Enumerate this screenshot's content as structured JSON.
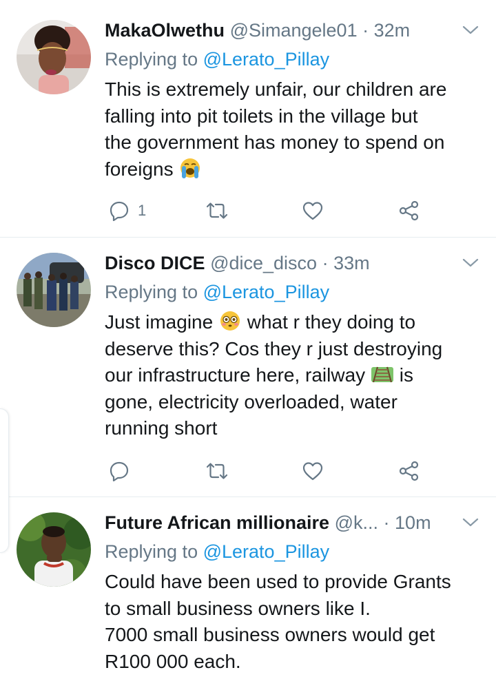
{
  "tweets": [
    {
      "name": "MakaOlwethu",
      "handle": "@Simangele01",
      "dot": "·",
      "time": "32m",
      "replying_prefix": "Replying to",
      "replying_to": "@Lerato_Pillay",
      "lines": [
        "This is extremely unfair, our children are",
        "falling into pit toilets in  the village but",
        "the government has money to spend on",
        "foreigns"
      ],
      "emoji": "loudly-crying-face-emoji",
      "reply_count": "1"
    },
    {
      "name": "Disco DICE",
      "handle": "@dice_disco",
      "dot": "·",
      "time": "33m",
      "replying_prefix": "Replying to",
      "replying_to": "@Lerato_Pillay",
      "lines": [
        "Just imagine",
        "what r they doing to",
        "deserve this? Cos they r just destroying",
        "our infrastructure here, railway",
        "is",
        "gone, electricity overloaded, water",
        "running short"
      ],
      "emoji": [
        "flushed-face-emoji",
        "railway-track-emoji"
      ]
    },
    {
      "name": "Future African millionaire",
      "handle": "@k...",
      "dot": "·",
      "time": "10m",
      "replying_prefix": "Replying to",
      "replying_to": "@Lerato_Pillay",
      "lines": [
        "Could have been used to provide Grants",
        "to small business owners like I.",
        "7000 small business owners would get",
        "R100 000 each."
      ]
    }
  ],
  "icons": [
    "reply-icon",
    "retweet-icon",
    "like-icon",
    "share-icon",
    "chevron-down-icon"
  ],
  "colors": {
    "text": "#14171a",
    "muted": "#657786",
    "link": "#1b95e0",
    "divider": "#e6ecf0"
  }
}
